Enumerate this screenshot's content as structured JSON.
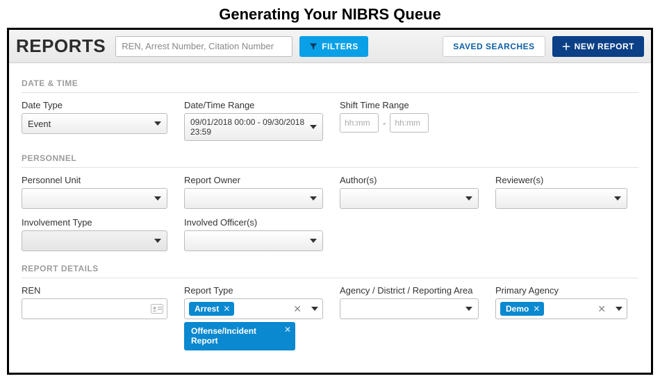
{
  "page": {
    "heading": "Generating Your NIBRS Queue"
  },
  "toolbar": {
    "brand": "REPORTS",
    "search_placeholder": "REN, Arrest Number, Citation Number",
    "filters_label": "FILTERS",
    "saved_label": "SAVED SEARCHES",
    "new_label": "NEW REPORT"
  },
  "sections": {
    "date_time": {
      "title": "DATE & TIME"
    },
    "personnel": {
      "title": "PERSONNEL"
    },
    "report_details": {
      "title": "REPORT DETAILS"
    }
  },
  "date_time": {
    "date_type_label": "Date Type",
    "date_type_value": "Event",
    "range_label": "Date/Time Range",
    "range_value": "09/01/2018 00:00 - 09/30/2018 23:59",
    "shift_label": "Shift Time Range",
    "shift_ph1": "hh:mm",
    "shift_sep": "-",
    "shift_ph2": "hh:mm"
  },
  "personnel": {
    "unit_label": "Personnel Unit",
    "owner_label": "Report Owner",
    "authors_label": "Author(s)",
    "reviewers_label": "Reviewer(s)",
    "involvement_label": "Involvement Type",
    "officers_label": "Involved Officer(s)"
  },
  "report_details": {
    "ren_label": "REN",
    "report_type_label": "Report Type",
    "agency_label": "Agency / District / Reporting Area",
    "primary_agency_label": "Primary Agency",
    "report_type_tags": {
      "t0": "Arrest",
      "t1": "Offense/Incident Report"
    },
    "primary_agency_tags": {
      "t0": "Demo"
    }
  }
}
